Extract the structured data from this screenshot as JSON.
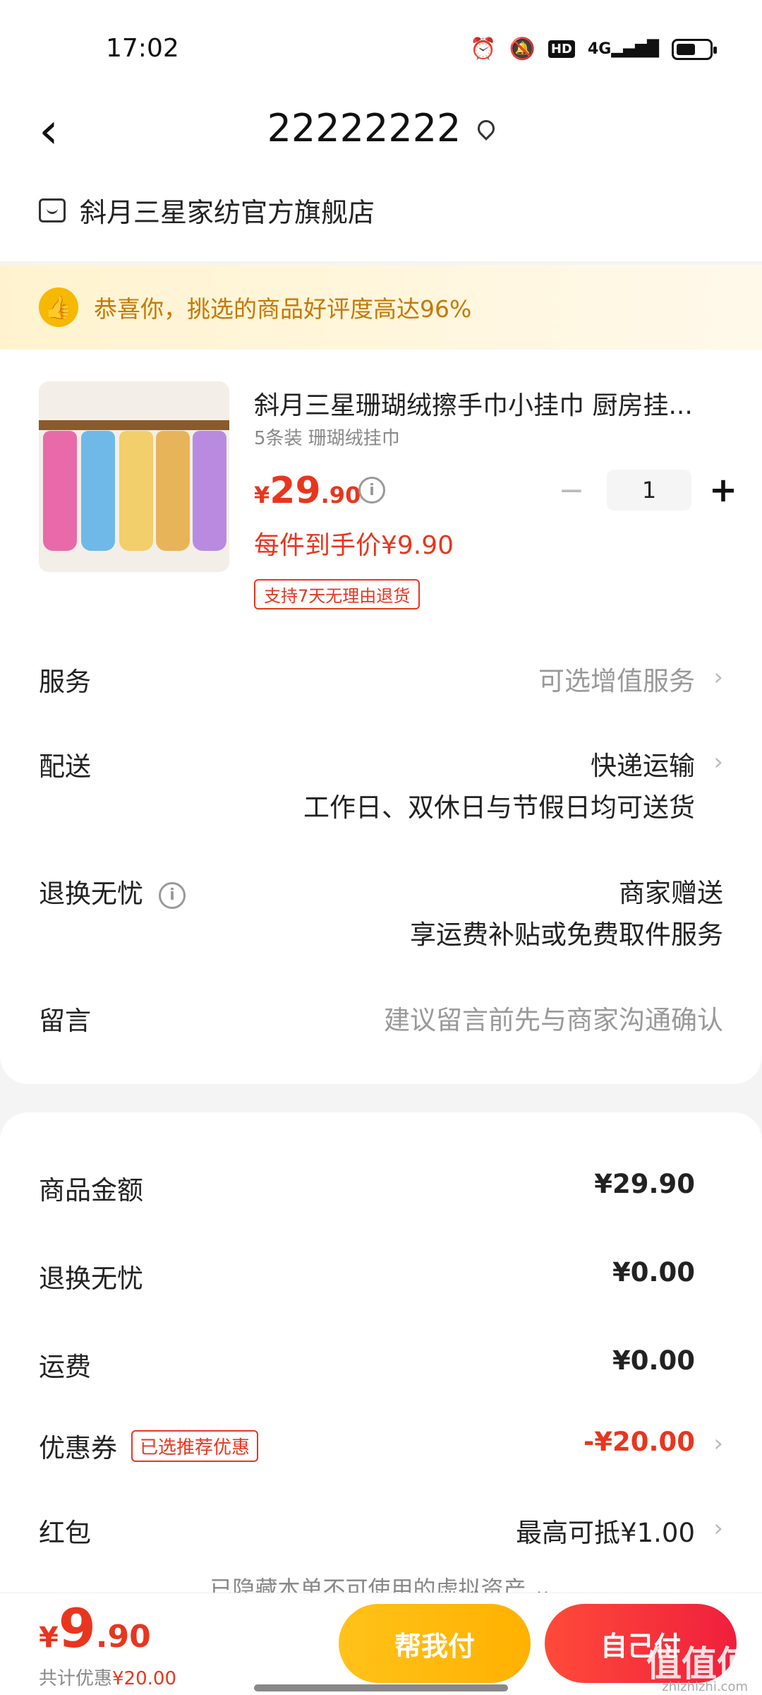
{
  "status_bar": {
    "time": "17:02",
    "network": "4G"
  },
  "header": {
    "title": "22222222",
    "store_name": "斜月三星家纺官方旗舰店"
  },
  "banner": {
    "text": "恭喜你，挑选的商品好评度高达96%"
  },
  "product": {
    "name": "斜月三星珊瑚绒擦手巾小挂巾 厨房挂...",
    "spec": "5条装 珊瑚绒挂巾",
    "price_currency": "¥",
    "price_int": "29",
    "price_dec": ".90",
    "per_item_price": "每件到手价¥9.90",
    "return_tag": "支持7天无理由退货",
    "quantity": "1",
    "towel_colors": [
      "#e96aa8",
      "#6fb9e8",
      "#f2cf6b",
      "#e8b45a",
      "#b98be0"
    ]
  },
  "rows": {
    "service_label": "服务",
    "service_value": "可选增值服务",
    "delivery_label": "配送",
    "delivery_value": "快递运输",
    "delivery_note": "工作日、双休日与节假日均可送货",
    "return_label": "退换无忧",
    "return_value": "商家赠送",
    "return_note": "享运费补贴或免费取件服务",
    "message_label": "留言",
    "message_placeholder": "建议留言前先与商家沟通确认"
  },
  "summary": {
    "goods_label": "商品金额",
    "goods_value": "¥29.90",
    "return_label": "退换无忧",
    "return_value": "¥0.00",
    "shipping_label": "运费",
    "shipping_value": "¥0.00",
    "coupon_label": "优惠券",
    "coupon_tag": "已选推荐优惠",
    "coupon_value": "-¥20.00",
    "redpacket_label": "红包",
    "redpacket_value": "最高可抵¥1.00",
    "hidden_assets": "已隐藏本单不可使用的虚拟资产 ⌄"
  },
  "bottom": {
    "total_currency": "¥",
    "total_int": "9",
    "total_dec": ".90",
    "saved_prefix": "共计优惠",
    "saved_amount": "¥20.00",
    "help_pay": "帮我付",
    "self_pay": "自己付",
    "watermark": "值值值",
    "watermark_sub": "zhizhizhi.com"
  }
}
